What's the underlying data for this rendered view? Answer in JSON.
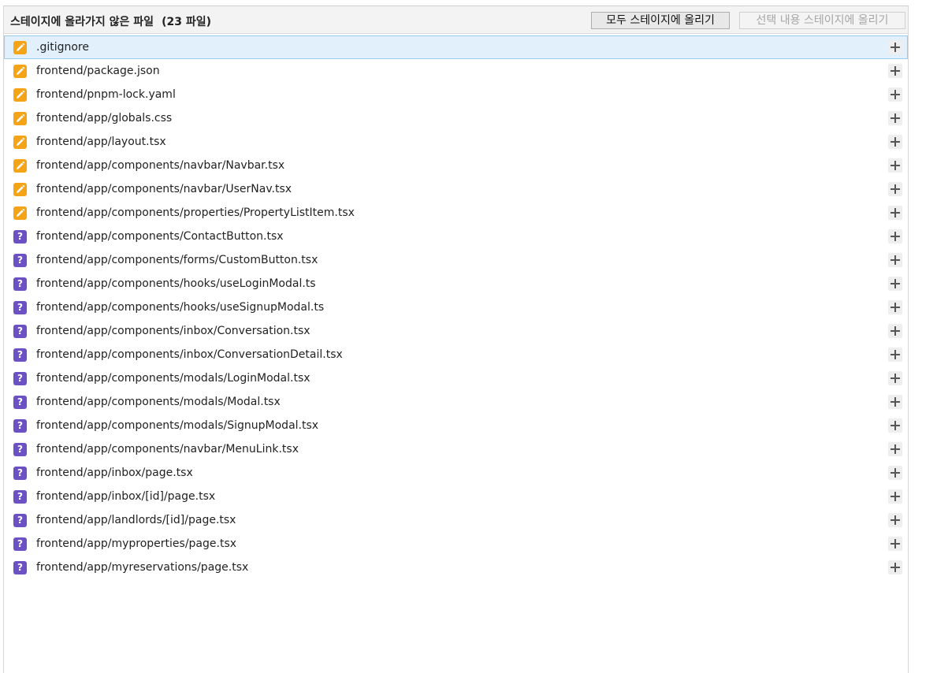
{
  "header": {
    "title": "스테이지에 올라가지 않은 파일",
    "count": "(23 파일)",
    "stage_all_label": "모두 스테이지에 올리기",
    "stage_selected_label": "선택 내용 스테이지에 올리기"
  },
  "colors": {
    "modified": "#f5a418",
    "untracked": "#6b51c4",
    "selected_row": "#e1f0fb"
  },
  "files": [
    {
      "path": ".gitignore",
      "status": "modified",
      "icon": "pencil-icon",
      "selected": true
    },
    {
      "path": "frontend/package.json",
      "status": "modified",
      "icon": "pencil-icon"
    },
    {
      "path": "frontend/pnpm-lock.yaml",
      "status": "modified",
      "icon": "pencil-icon"
    },
    {
      "path": "frontend/app/globals.css",
      "status": "modified",
      "icon": "pencil-icon"
    },
    {
      "path": "frontend/app/layout.tsx",
      "status": "modified",
      "icon": "pencil-icon"
    },
    {
      "path": "frontend/app/components/navbar/Navbar.tsx",
      "status": "modified",
      "icon": "pencil-icon"
    },
    {
      "path": "frontend/app/components/navbar/UserNav.tsx",
      "status": "modified",
      "icon": "pencil-icon"
    },
    {
      "path": "frontend/app/components/properties/PropertyListItem.tsx",
      "status": "modified",
      "icon": "pencil-icon"
    },
    {
      "path": "frontend/app/components/ContactButton.tsx",
      "status": "untracked",
      "icon": "question-icon"
    },
    {
      "path": "frontend/app/components/forms/CustomButton.tsx",
      "status": "untracked",
      "icon": "question-icon"
    },
    {
      "path": "frontend/app/components/hooks/useLoginModal.ts",
      "status": "untracked",
      "icon": "question-icon"
    },
    {
      "path": "frontend/app/components/hooks/useSignupModal.ts",
      "status": "untracked",
      "icon": "question-icon"
    },
    {
      "path": "frontend/app/components/inbox/Conversation.tsx",
      "status": "untracked",
      "icon": "question-icon"
    },
    {
      "path": "frontend/app/components/inbox/ConversationDetail.tsx",
      "status": "untracked",
      "icon": "question-icon"
    },
    {
      "path": "frontend/app/components/modals/LoginModal.tsx",
      "status": "untracked",
      "icon": "question-icon"
    },
    {
      "path": "frontend/app/components/modals/Modal.tsx",
      "status": "untracked",
      "icon": "question-icon"
    },
    {
      "path": "frontend/app/components/modals/SignupModal.tsx",
      "status": "untracked",
      "icon": "question-icon"
    },
    {
      "path": "frontend/app/components/navbar/MenuLink.tsx",
      "status": "untracked",
      "icon": "question-icon"
    },
    {
      "path": "frontend/app/inbox/page.tsx",
      "status": "untracked",
      "icon": "question-icon"
    },
    {
      "path": "frontend/app/inbox/[id]/page.tsx",
      "status": "untracked",
      "icon": "question-icon"
    },
    {
      "path": "frontend/app/landlords/[id]/page.tsx",
      "status": "untracked",
      "icon": "question-icon"
    },
    {
      "path": "frontend/app/myproperties/page.tsx",
      "status": "untracked",
      "icon": "question-icon"
    },
    {
      "path": "frontend/app/myreservations/page.tsx",
      "status": "untracked",
      "icon": "question-icon"
    }
  ]
}
